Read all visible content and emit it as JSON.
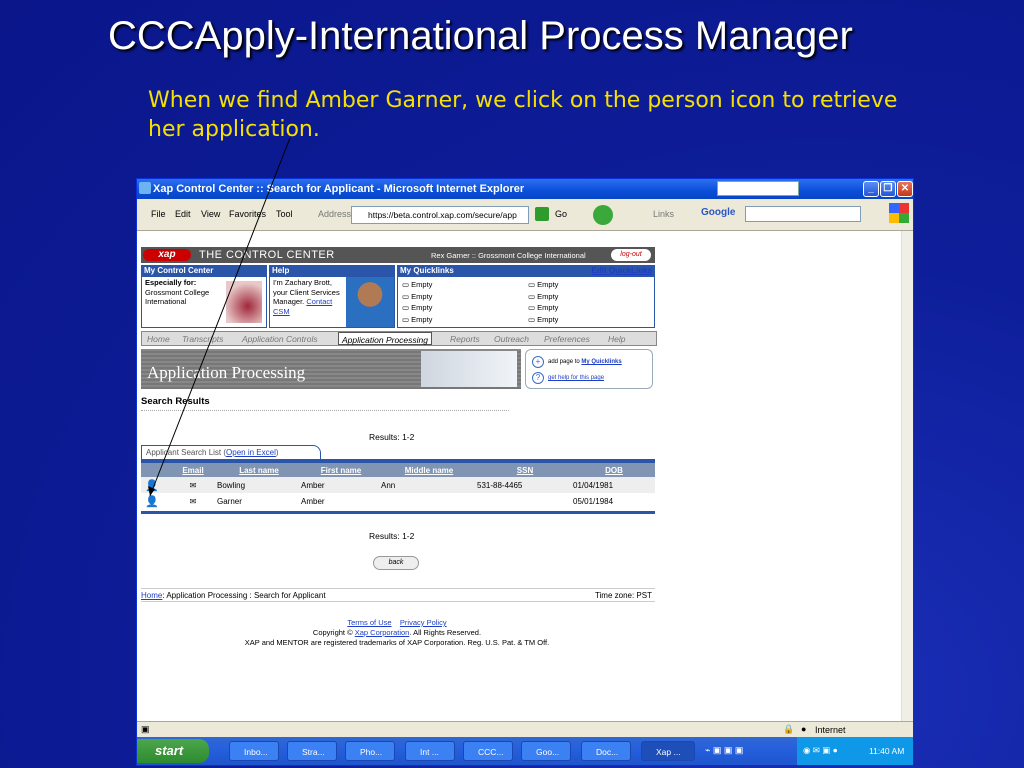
{
  "slide": {
    "title": "CCCApply-International Process Manager",
    "subtitle": "When we find Amber Garner, we click on the person icon to retrieve her application."
  },
  "browser": {
    "title": "Xap Control Center :: Search for Applicant - Microsoft Internet Explorer",
    "menu": [
      "File",
      "Edit",
      "View",
      "Favorites",
      "Tool"
    ],
    "address_label": "Address",
    "url": "https://beta.control.xap.com/secure/app",
    "go": "Go",
    "links": "Links",
    "google": "Google",
    "status_zone": "Internet"
  },
  "header": {
    "logo": "xap",
    "title": "THE CONTROL CENTER",
    "user": "Rex Garner :: Grossmont College International",
    "logout": "log-out"
  },
  "panels": {
    "mycc": {
      "title": "My Control Center",
      "especially": "Especially for:",
      "org_line1": "Grossmont College",
      "org_line2": "International"
    },
    "help": {
      "title": "Help",
      "line1": "I'm Zachary Brott,",
      "line2": "your Client Services",
      "line3": "Manager.",
      "contact_link": "Contact",
      "csm_link": "CSM"
    },
    "quick": {
      "title": "My Quicklinks",
      "edit": "Edit QuickLinks",
      "items": [
        "Empty",
        "Empty",
        "Empty",
        "Empty",
        "Empty",
        "Empty",
        "Empty",
        "Empty"
      ]
    }
  },
  "nav": [
    "Home",
    "Transcripts",
    "Application Controls",
    "Application Processing",
    "Reports",
    "Outreach",
    "Preferences",
    "Help"
  ],
  "banner": {
    "title": "Application Processing",
    "add_prefix": "add page to",
    "add_link": "My Quicklinks",
    "help_link": "get help for this page"
  },
  "search": {
    "heading": "Search Results",
    "results": "Results: 1-2",
    "list_tab": "Applicant Search List",
    "excel": "Open in Excel",
    "columns": [
      "Email",
      "Last name",
      "First name",
      "Middle name",
      "SSN",
      "DOB"
    ],
    "rows": [
      {
        "last": "Bowling",
        "first": "Amber",
        "middle": "Ann",
        "ssn": "531-88-4465",
        "dob": "01/04/1981"
      },
      {
        "last": "Garner",
        "first": "Amber",
        "middle": "",
        "ssn": "",
        "dob": "05/01/1984"
      }
    ],
    "results_bottom": "Results: 1-2",
    "back": "back"
  },
  "breadcrumb": {
    "home": "Home",
    "rest": ": Application Processing : Search for Applicant",
    "tz": "Time zone: PST"
  },
  "footer": {
    "terms": "Terms of Use",
    "privacy": "Privacy Policy",
    "copy_prefix": "Copyright ©",
    "copy_link": "Xap Corporation",
    "copy_suffix": ". All Rights Reserved.",
    "trademark": "XAP and MENTOR are registered trademarks of XAP Corporation. Reg. U.S. Pat. & TM Off."
  },
  "taskbar": {
    "start": "start",
    "items": [
      "Inbo...",
      "Stra...",
      "Pho...",
      "Int ...",
      "CCC...",
      "Goo...",
      "Doc...",
      "Xap ..."
    ],
    "clock": "11:40 AM"
  },
  "colors": {
    "slide_bg": "#0e1e9a",
    "subtitle": "#f5e000",
    "panel_blue": "#2b55a8"
  }
}
